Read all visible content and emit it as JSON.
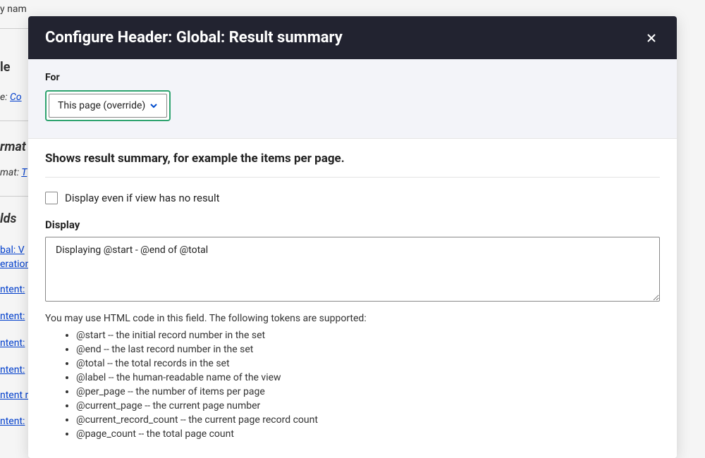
{
  "modal": {
    "title": "Configure Header: Global: Result summary",
    "for_label": "For",
    "for_value": "This page (override)",
    "description": "Shows result summary, for example the items per page.",
    "checkbox_label": "Display even if view has no result",
    "display_label": "Display",
    "display_value": "Displaying @start - @end of @total",
    "help_text": "You may use HTML code in this field. The following tokens are supported:",
    "tokens": [
      "@start -- the initial record number in the set",
      "@end -- the last record number in the set",
      "@total -- the total records in the set",
      "@label -- the human-readable name of the view",
      "@per_page -- the number of items per page",
      "@current_page -- the current page number",
      "@current_record_count -- the current page record count",
      "@page_count -- the total page count"
    ]
  },
  "background": {
    "name_fragment": "y nam",
    "le_fragment": "le",
    "e_label": "e:",
    "co_link": "Co",
    "rmat_heading": "rmat",
    "mat_label": "mat:",
    "t_link": "T",
    "lds_heading": "lds",
    "link1a": "bal: V",
    "link1b": "eration",
    "link2": "ntent:",
    "link3": "ntent:",
    "link4": "ntent:",
    "link5": "ntent:",
    "link6": "ntent r",
    "link7": "ntent:"
  }
}
